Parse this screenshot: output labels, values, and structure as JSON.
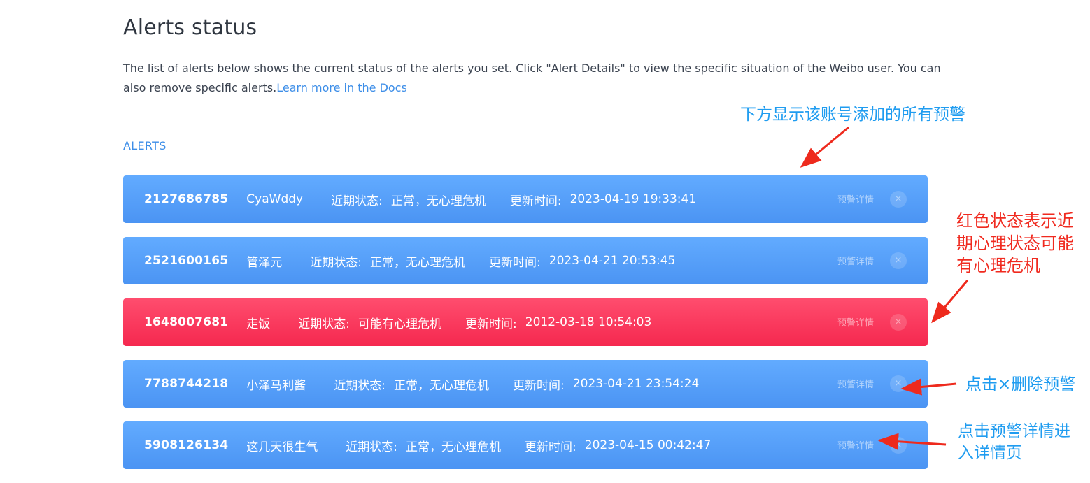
{
  "page": {
    "title": "Alerts status",
    "intro_text": "The list of alerts below shows the current status of the alerts you set. Click \"Alert Details\" to view the specific situation of the Weibo user. You can also remove specific alerts.",
    "docs_link": "Learn more in the Docs",
    "section_label": "ALERTS"
  },
  "labels": {
    "status": "近期状态:",
    "time": "更新时间:",
    "details": "预警详情",
    "close": "×"
  },
  "alerts": [
    {
      "id": "2127686785",
      "name": "CyaWddy",
      "status": "正常，无心理危机",
      "time": "2023-04-19 19:33:41",
      "level": "normal"
    },
    {
      "id": "2521600165",
      "name": "管泽元",
      "status": "正常，无心理危机",
      "time": "2023-04-21 20:53:45",
      "level": "normal"
    },
    {
      "id": "1648007681",
      "name": "走饭",
      "status": "可能有心理危机",
      "time": "2012-03-18 10:54:03",
      "level": "danger"
    },
    {
      "id": "7788744218",
      "name": "小泽马利酱",
      "status": "正常，无心理危机",
      "time": "2023-04-21 23:54:24",
      "level": "normal"
    },
    {
      "id": "5908126134",
      "name": "这几天很生气",
      "status": "正常，无心理危机",
      "time": "2023-04-15 00:42:47",
      "level": "normal"
    }
  ],
  "annotations": {
    "top": "下方显示该账号添加的所有预警",
    "red_status": "红色状态表示近期心理状态可能有心理危机",
    "delete": "点击×删除预警",
    "details": "点击预警详情进入详情页"
  },
  "colors": {
    "normal_row": "#5aa2fb",
    "danger_row": "#fb3a5f",
    "accent_link": "#3d8ee8",
    "annotation_blue": "#1f9cf0",
    "annotation_red": "#f02a1f"
  },
  "icons": {
    "close": "close-icon"
  }
}
